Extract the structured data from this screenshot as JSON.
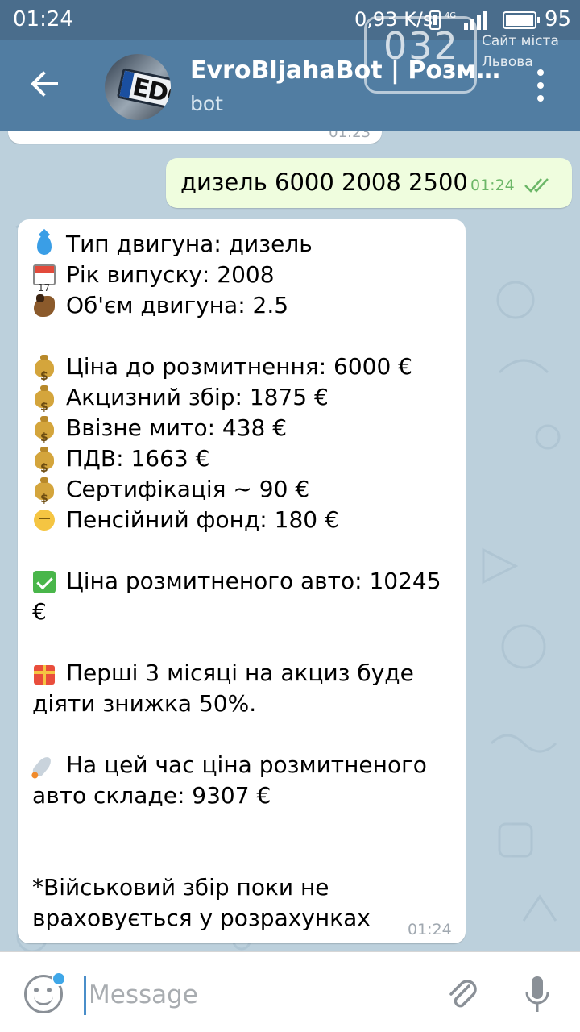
{
  "status_bar": {
    "time": "01:24",
    "network_speed": "0,93 K/s",
    "network_type": "4G",
    "battery": "95"
  },
  "watermark": {
    "logo_number": "032",
    "text": "Сайт міста Львова"
  },
  "header": {
    "title": "EvroBljahaBot | Розм...",
    "subtitle": "bot",
    "avatar_text": "EDO"
  },
  "previous_message": {
    "time": "01:23"
  },
  "outgoing_message": {
    "text": "дизель 6000 2008 2500",
    "time": "01:24",
    "status_icon": "double-check-icon"
  },
  "incoming_message": {
    "lines": {
      "engine_type": {
        "emoji": "droplet-icon",
        "text": "Тип двигуна: дизель"
      },
      "year": {
        "emoji": "calendar-icon",
        "text": "Рік випуску: 2008"
      },
      "volume": {
        "emoji": "horse-icon",
        "text": "Об'єм двигуна: 2.5"
      },
      "price_before": {
        "emoji": "money-bag-icon",
        "text": "Ціна до розмитнення: 6000 €"
      },
      "excise": {
        "emoji": "money-bag-icon",
        "text": "Акцизний збір: 1875 €"
      },
      "import_duty": {
        "emoji": "money-bag-icon",
        "text": "Ввізне мито: 438 €"
      },
      "vat": {
        "emoji": "money-bag-icon",
        "text": "ПДВ: 1663 €"
      },
      "certification": {
        "emoji": "money-bag-icon",
        "text": "Сертифікація ~ 90 €"
      },
      "pension_fund": {
        "emoji": "face-icon",
        "text": "Пенсійний фонд: 180 €"
      },
      "total_price": {
        "emoji": "check-mark-icon",
        "text": "Ціна розмитненого авто: 10245 €"
      },
      "discount": {
        "emoji": "gift-icon",
        "text": "Перші 3 місяці на акциз буде діяти знижка 50%."
      },
      "current_price": {
        "emoji": "rocket-icon",
        "text": "На цей час ціна розмитненого авто складе: 9307 €"
      },
      "note": {
        "text": "*Військовий збір поки не враховується у розрахунках"
      }
    },
    "time": "01:24"
  },
  "input_bar": {
    "placeholder": "Message",
    "value": ""
  },
  "colors": {
    "header": "#517da2",
    "status_bar": "#4a6d8c",
    "chat_background": "#bcd0dc",
    "outgoing_bubble": "#effdde",
    "incoming_bubble": "#ffffff",
    "check_green": "#6cb768"
  }
}
